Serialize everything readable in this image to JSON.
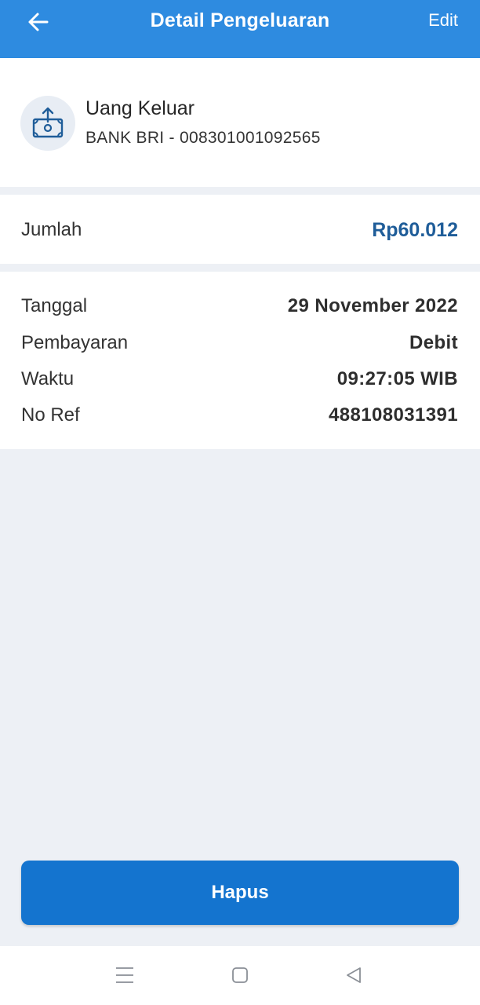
{
  "header": {
    "title": "Detail Pengeluaran",
    "edit_label": "Edit",
    "back_icon": "arrow-left-icon",
    "background": "#2e8be0"
  },
  "account": {
    "icon": "money-out-icon",
    "title": "Uang Keluar",
    "subtitle": "BANK BRI - 008301001092565"
  },
  "amount": {
    "label": "Jumlah",
    "value": "Rp60.012",
    "color": "#1f5d99"
  },
  "details": [
    {
      "label": "Tanggal",
      "value": "29 November 2022"
    },
    {
      "label": "Pembayaran",
      "value": "Debit"
    },
    {
      "label": "Waktu",
      "value": "09:27:05 WIB"
    },
    {
      "label": "No Ref",
      "value": "488108031391"
    }
  ],
  "actions": {
    "delete_label": "Hapus",
    "delete_color": "#1474cf"
  },
  "navbar": {
    "menu_icon": "menu-icon",
    "home_icon": "home-square-icon",
    "back_icon": "back-triangle-icon"
  }
}
